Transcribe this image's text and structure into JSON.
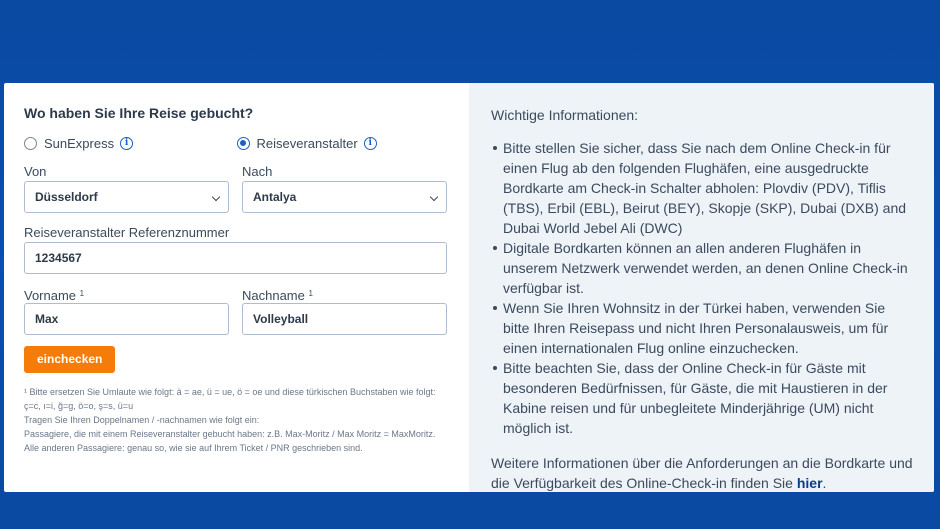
{
  "form": {
    "heading": "Wo haben Sie Ihre Reise gebucht?",
    "radios": [
      {
        "label": "SunExpress",
        "checked": false,
        "icon": "info-icon"
      },
      {
        "label": "Reiseveranstalter",
        "checked": true,
        "icon": "info-icon"
      }
    ],
    "von": {
      "label": "Von",
      "value": "Düsseldorf"
    },
    "nach": {
      "label": "Nach",
      "value": "Antalya"
    },
    "referenz": {
      "label": "Reiseveranstalter Referenznummer",
      "value": "1234567"
    },
    "vorname": {
      "label": "Vorname",
      "sup": "1",
      "value": "Max"
    },
    "nachname": {
      "label": "Nachname",
      "sup": "1",
      "value": "Volleyball"
    },
    "submit_label": "einchecken",
    "footnote": [
      "¹ Bitte ersetzen Sie Umlaute wie folgt: ä = ae, ü = ue, ö = oe und diese türkischen Buchstaben wie folgt: ç=c, ı=i, ğ=g, ö=o, ş=s, ü=u",
      "Tragen Sie Ihren Doppelnamen / -nachnamen wie folgt ein:",
      "Passagiere, die mit einem Reiseveranstalter gebucht haben: z.B. Max-Moritz / Max Moritz = MaxMoritz.",
      "Alle anderen Passagiere: genau so, wie sie auf Ihrem Ticket / PNR geschrieben sind."
    ]
  },
  "info": {
    "title": "Wichtige Informationen:",
    "items": [
      "Bitte stellen Sie sicher, dass Sie nach dem Online Check-in für einen Flug ab den folgenden Flughäfen, eine ausgedruckte Bordkarte am Check-in Schalter abholen: Plovdiv (PDV), Tiflis (TBS), Erbil (EBL), Beirut (BEY), Skopje (SKP), Dubai (DXB) and Dubai World Jebel Ali (DWC)",
      "Digitale Bordkarten können an allen anderen Flughäfen in unserem Netzwerk verwendet werden, an denen Online Check-in verfügbar ist.",
      "Wenn Sie Ihren Wohnsitz in der Türkei haben, verwenden Sie bitte Ihren Reisepass und nicht Ihren Personalausweis, um für einen internationalen Flug online einzuchecken.",
      "Bitte beachten Sie, dass der Online Check-in für Gäste mit besonderen Bedürfnissen, für Gäste, die mit Haustieren in der Kabine reisen und für unbegleitete Minderjährige (UM) nicht möglich ist."
    ],
    "more_text": "Weitere Informationen über die Anforderungen an die Bordkarte und die Verfügbarkeit des Online-Check-in finden Sie ",
    "more_link": "hier",
    "more_end": "."
  },
  "colors": {
    "background": "#0b4db0",
    "accent": "#f57c08",
    "link": "#0b3c8c"
  }
}
